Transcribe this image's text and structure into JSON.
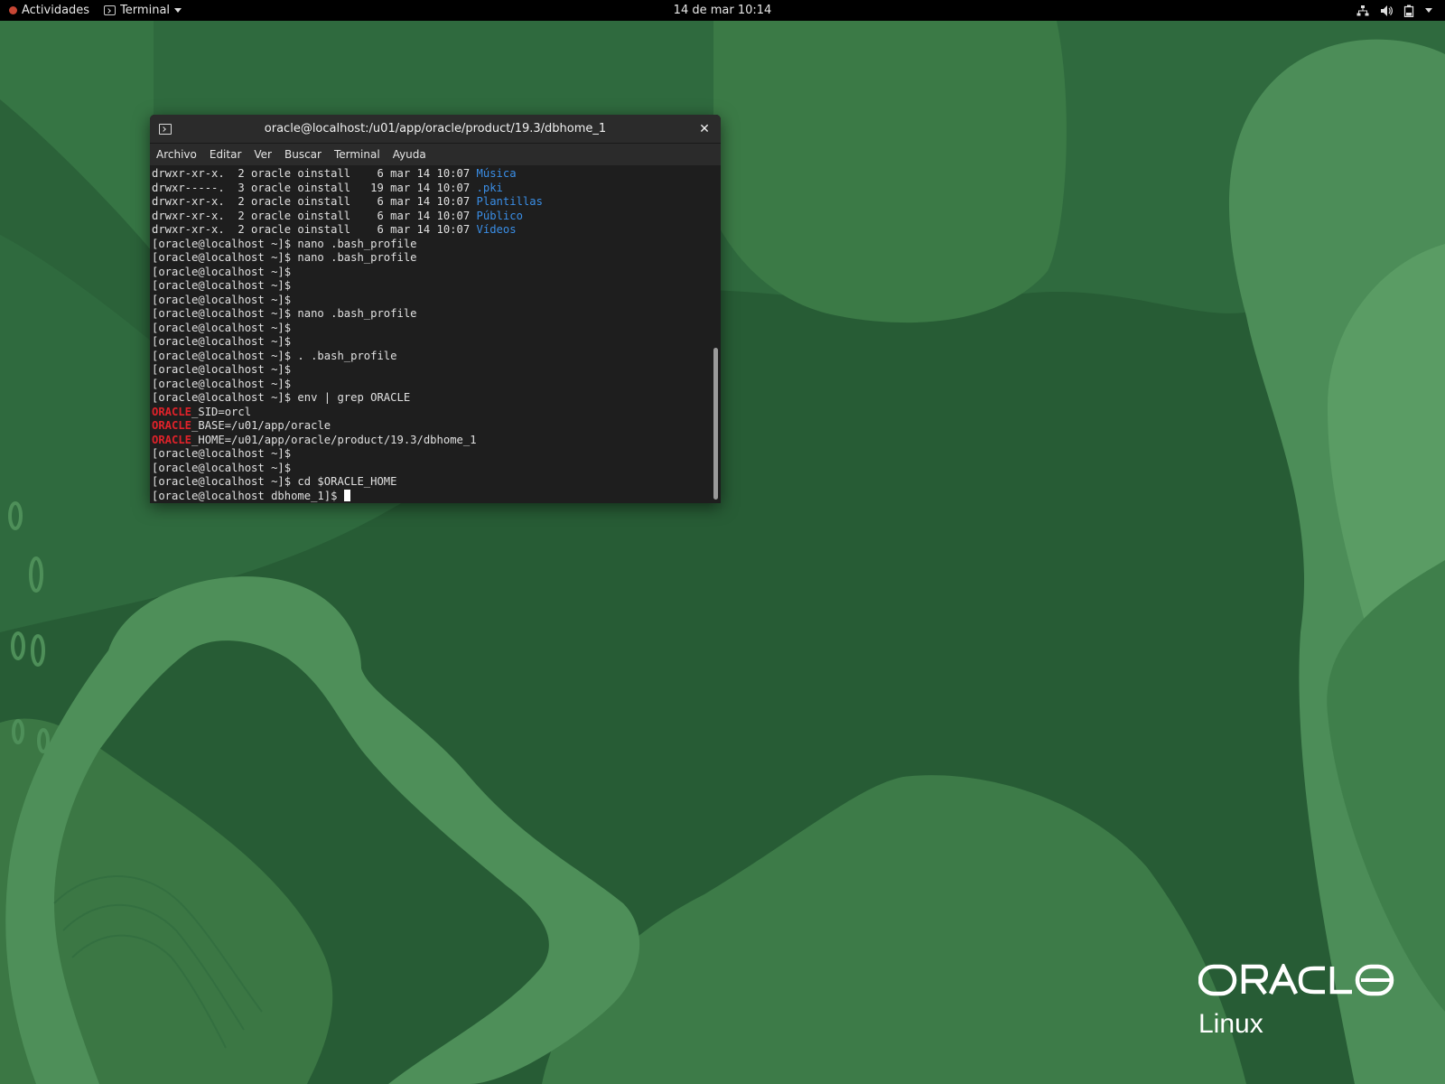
{
  "topbar": {
    "activities": "Actividades",
    "app_menu": "Terminal",
    "clock": "14 de mar  10:14"
  },
  "terminal": {
    "title": "oracle@localhost:/u01/app/oracle/product/19.3/dbhome_1",
    "menu": [
      "Archivo",
      "Editar",
      "Ver",
      "Buscar",
      "Terminal",
      "Ayuda"
    ],
    "lines": [
      {
        "text": "drwxr-xr-x.  2 oracle oinstall    6 mar 14 10:07 ",
        "highlight": "Música",
        "hcls": "blue"
      },
      {
        "text": "drwxr-----.  3 oracle oinstall   19 mar 14 10:07 ",
        "highlight": ".pki",
        "hcls": "blue"
      },
      {
        "text": "drwxr-xr-x.  2 oracle oinstall    6 mar 14 10:07 ",
        "highlight": "Plantillas",
        "hcls": "blue"
      },
      {
        "text": "drwxr-xr-x.  2 oracle oinstall    6 mar 14 10:07 ",
        "highlight": "Público",
        "hcls": "blue"
      },
      {
        "text": "drwxr-xr-x.  2 oracle oinstall    6 mar 14 10:07 ",
        "highlight": "Vídeos",
        "hcls": "blue"
      },
      {
        "text": "[oracle@localhost ~]$ nano .bash_profile"
      },
      {
        "text": "[oracle@localhost ~]$ nano .bash_profile"
      },
      {
        "text": "[oracle@localhost ~]$"
      },
      {
        "text": "[oracle@localhost ~]$"
      },
      {
        "text": "[oracle@localhost ~]$"
      },
      {
        "text": "[oracle@localhost ~]$ nano .bash_profile"
      },
      {
        "text": "[oracle@localhost ~]$"
      },
      {
        "text": "[oracle@localhost ~]$"
      },
      {
        "text": "[oracle@localhost ~]$ . .bash_profile"
      },
      {
        "text": "[oracle@localhost ~]$"
      },
      {
        "text": "[oracle@localhost ~]$"
      },
      {
        "text": "[oracle@localhost ~]$ env | grep ORACLE"
      },
      {
        "prefix": "ORACLE",
        "pcls": "red",
        "text": "_SID=orcl"
      },
      {
        "prefix": "ORACLE",
        "pcls": "red",
        "text": "_BASE=/u01/app/oracle"
      },
      {
        "prefix": "ORACLE",
        "pcls": "red",
        "text": "_HOME=/u01/app/oracle/product/19.3/dbhome_1"
      },
      {
        "text": "[oracle@localhost ~]$"
      },
      {
        "text": "[oracle@localhost ~]$"
      },
      {
        "text": "[oracle@localhost ~]$ cd $ORACLE_HOME"
      },
      {
        "text": "[oracle@localhost dbhome_1]$ ",
        "cursor": true
      }
    ]
  },
  "logo": {
    "brand": "ORACLE",
    "product": "Linux"
  },
  "colors": {
    "topbar_bg": "#000000",
    "terminal_bg": "#1e1e1e",
    "dir_blue": "#3a8ee6",
    "grep_red": "#e0222a",
    "desktop_green": "#2f6a3e"
  }
}
